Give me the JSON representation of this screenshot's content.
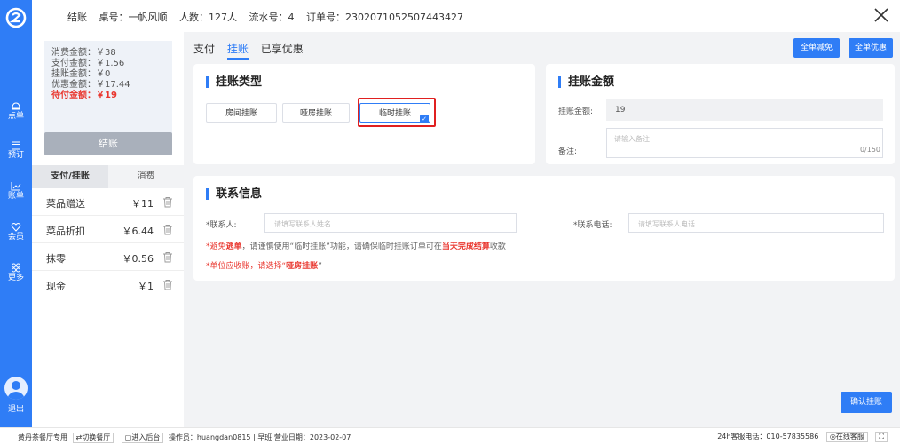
{
  "header": {
    "mode": "结账",
    "table": "桌号：一帆风顺",
    "guests": "人数：127人",
    "serial": "流水号：4",
    "order": "订单号：2302071052507443427"
  },
  "nav": {
    "items": [
      {
        "label": "点单",
        "icon": "bell-icon"
      },
      {
        "label": "预订",
        "icon": "calendar-icon"
      },
      {
        "label": "账单",
        "icon": "chart-icon"
      },
      {
        "label": "会员",
        "icon": "heart-icon"
      },
      {
        "label": "更多",
        "icon": "grid-icon"
      }
    ],
    "logout": "退出"
  },
  "summary": {
    "consume": "消费金额：￥38",
    "paid": "支付金额：￥1.56",
    "credit": "挂账金额：￥0",
    "discount": "优惠金额：￥17.44",
    "pending": "待付金额：￥19"
  },
  "left": {
    "settle_label": "结账",
    "tab_pay": "支付/挂账",
    "tab_consume": "消费",
    "rows": [
      {
        "name": "菜品赠送",
        "value": "￥11"
      },
      {
        "name": "菜品折扣",
        "value": "￥6.44"
      },
      {
        "name": "抹零",
        "value": "￥0.56"
      },
      {
        "name": "现金",
        "value": "￥1"
      }
    ]
  },
  "main": {
    "tabs": [
      "支付",
      "挂账",
      "已享优惠"
    ],
    "active_tab": "挂账",
    "btn_full_reduce": "全单减免",
    "btn_full_discount": "全单优惠",
    "type_title": "挂账类型",
    "types": [
      "房间挂账",
      "哑房挂账",
      "临时挂账"
    ],
    "selected_type": "临时挂账",
    "amount_title": "挂账金额",
    "amount_label": "挂账金额:",
    "amount_value": "19",
    "remark_label": "备注:",
    "remark_placeholder": "请输入备注",
    "remark_count": "0/150",
    "contact_title": "联系信息",
    "contact_label": "*联系人:",
    "contact_placeholder": "请填写联系人姓名",
    "phone_label": "*联系电话:",
    "phone_placeholder": "请填写联系人电话",
    "note1_a": "*避免",
    "note1_b": "逃单",
    "note1_c": "，请谨慎使用“临时挂账”功能，请确保临时挂账订单可在",
    "note1_d": "当天完成结算",
    "note1_e": "收款",
    "note2_a": "*单位应收账，请选择“",
    "note2_b": "哑房挂账",
    "note2_c": "”",
    "confirm": "确认挂账"
  },
  "footer": {
    "brand": "黄丹茶餐厅专用",
    "switch": "切换餐厅",
    "backend": "进入后台",
    "operator": "操作员：huangdan0815",
    "shift": "早班",
    "biz_date": "营业日期：2023-02-07",
    "hotline": "24h客服电话：010-57835586",
    "online": "在线客服"
  },
  "colors": {
    "accent": "#2f7df6",
    "danger": "#e9362e",
    "highlight_box": "#e02020"
  }
}
